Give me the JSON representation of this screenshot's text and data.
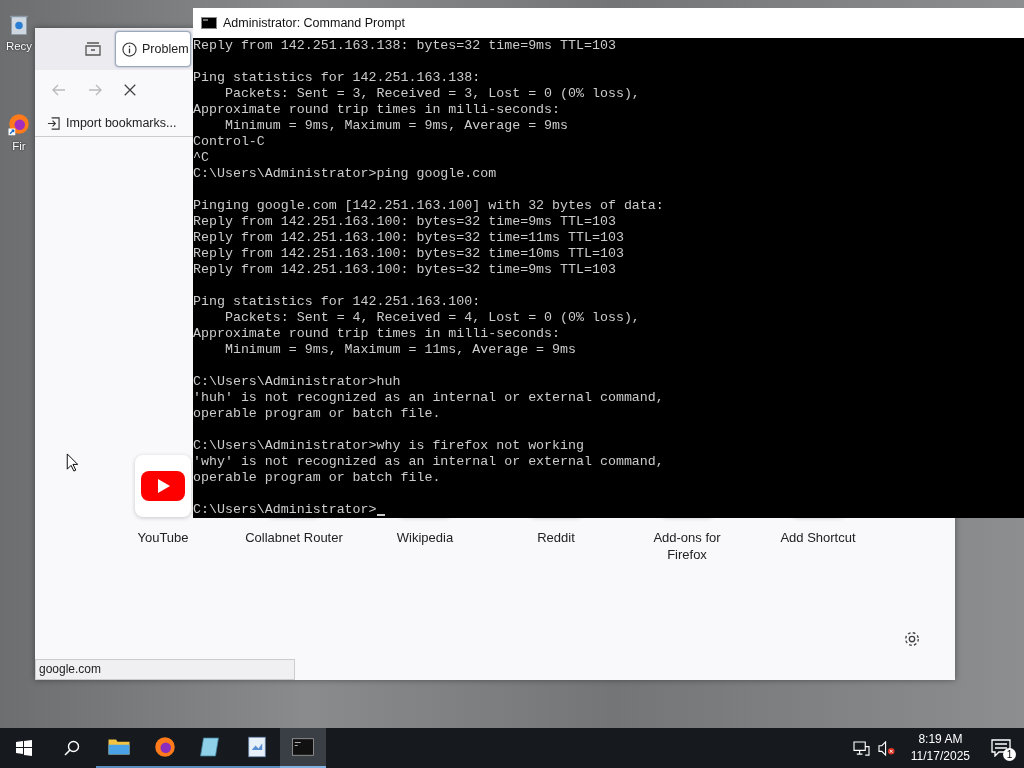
{
  "desktop_icons": [
    {
      "label": "Recy",
      "kind": "bin"
    },
    {
      "label": "Fir",
      "kind": "firefox"
    }
  ],
  "browser": {
    "tab": {
      "title": "Problem",
      "selected": true
    },
    "bookmarks": [
      "Import bookmarks..."
    ],
    "shortcuts": [
      {
        "label": "YouTube",
        "kind": "youtube"
      },
      {
        "label": "Collabnet Router",
        "kind": "site"
      },
      {
        "label": "Wikipedia",
        "kind": "site"
      },
      {
        "label": "Reddit",
        "kind": "site"
      },
      {
        "label": "Add-ons for Firefox",
        "kind": "site"
      },
      {
        "label": "Add Shortcut",
        "kind": "add"
      }
    ],
    "status": "google.com"
  },
  "console": {
    "title": "Administrator: Command Prompt",
    "blocks": [
      [
        "Reply from 142.251.163.138: bytes=32 time=9ms TTL=103"
      ],
      [
        "Ping statistics for 142.251.163.138:",
        "    Packets: Sent = 3, Received = 3, Lost = 0 (0% loss),",
        "Approximate round trip times in milli-seconds:",
        "    Minimum = 9ms, Maximum = 9ms, Average = 9ms",
        "Control-C",
        "^C",
        "C:\\Users\\Administrator>ping google.com"
      ],
      [
        "Pinging google.com [142.251.163.100] with 32 bytes of data:",
        "Reply from 142.251.163.100: bytes=32 time=9ms TTL=103",
        "Reply from 142.251.163.100: bytes=32 time=11ms TTL=103",
        "Reply from 142.251.163.100: bytes=32 time=10ms TTL=103",
        "Reply from 142.251.163.100: bytes=32 time=9ms TTL=103"
      ],
      [
        "Ping statistics for 142.251.163.100:",
        "    Packets: Sent = 4, Received = 4, Lost = 0 (0% loss),",
        "Approximate round trip times in milli-seconds:",
        "    Minimum = 9ms, Maximum = 11ms, Average = 9ms"
      ],
      [
        "C:\\Users\\Administrator>huh",
        "'huh' is not recognized as an internal or external command,",
        "operable program or batch file."
      ],
      [
        "C:\\Users\\Administrator>why is firefox not working",
        "'why' is not recognized as an internal or external command,",
        "operable program or batch file."
      ],
      [
        "C:\\Users\\Administrator>"
      ]
    ]
  },
  "taskbar": {
    "apps": [
      {
        "kind": "explorer",
        "selected": false
      },
      {
        "kind": "firefox",
        "selected": false
      },
      {
        "kind": "notepad",
        "selected": false
      },
      {
        "kind": "paint",
        "selected": false
      },
      {
        "kind": "console",
        "selected": true
      }
    ],
    "time": "8:19 AM",
    "date": "11/17/2025",
    "notifications": "1"
  }
}
